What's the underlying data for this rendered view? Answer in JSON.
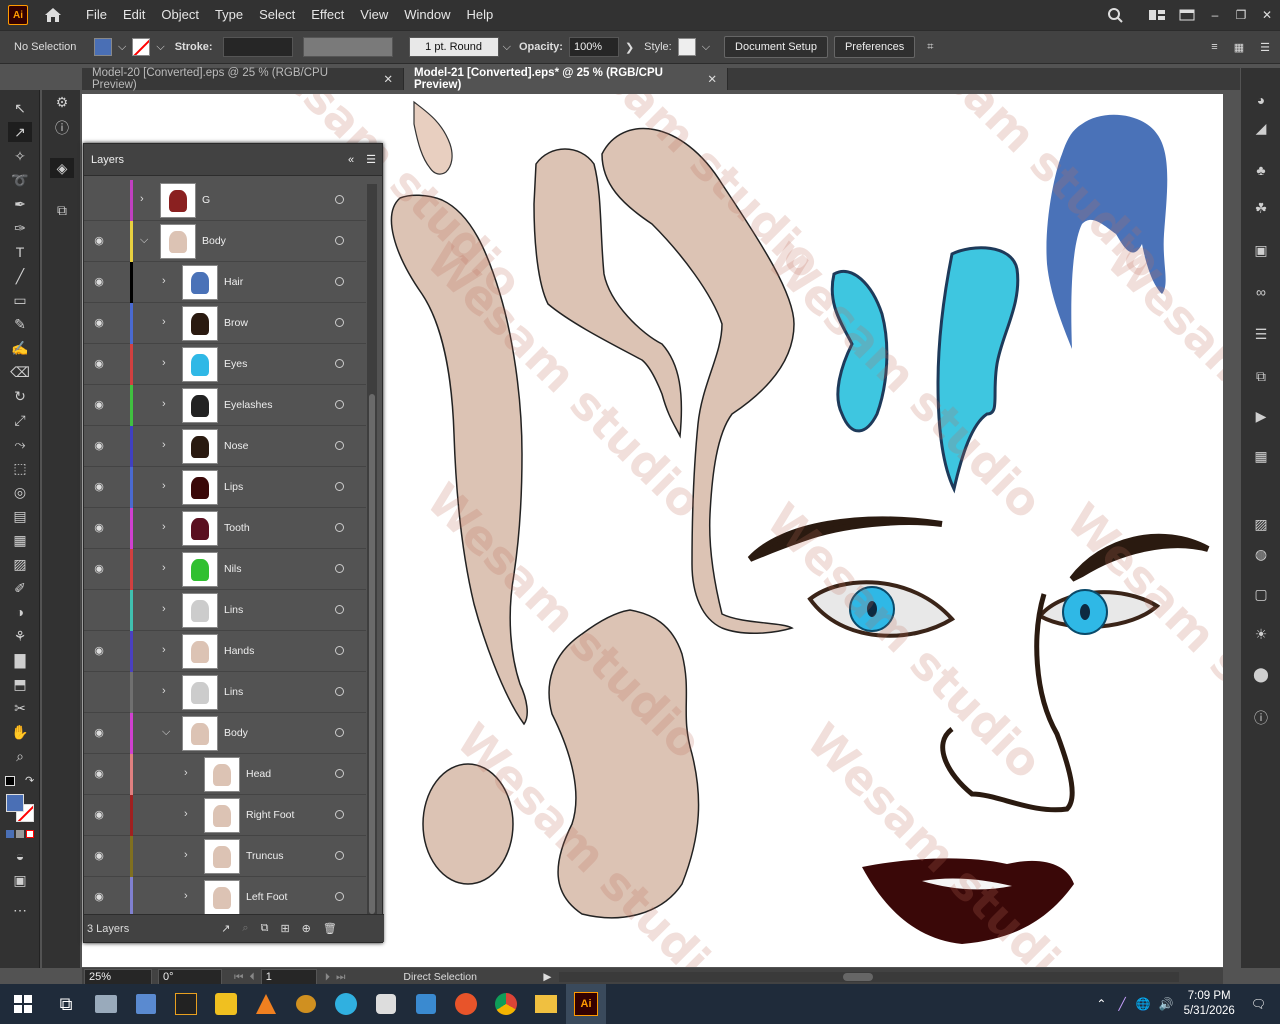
{
  "menubar": {
    "items": [
      "File",
      "Edit",
      "Object",
      "Type",
      "Select",
      "Effect",
      "View",
      "Window",
      "Help"
    ],
    "app_logo": "Ai"
  },
  "controlbar": {
    "selection": "No Selection",
    "stroke_label": "Stroke:",
    "brush": "1 pt. Round",
    "opacity_label": "Opacity:",
    "opacity_value": "100%",
    "style_label": "Style:",
    "document_setup": "Document Setup",
    "preferences": "Preferences",
    "fill_color": "#4a6fb5"
  },
  "tabs": [
    {
      "label": "Model-20 [Converted].eps @ 25 % (RGB/CPU Preview)",
      "active": false
    },
    {
      "label": "Model-21 [Converted].eps* @ 25 % (RGB/CPU Preview)",
      "active": true
    }
  ],
  "layers_panel": {
    "title": "Layers",
    "footer_count": "3 Layers",
    "rows": [
      {
        "name": "G",
        "color": "#c040c0",
        "eye": false,
        "level": 0,
        "expanded": false
      },
      {
        "name": "Body",
        "color": "#e8d040",
        "eye": true,
        "level": 0,
        "expanded": true
      },
      {
        "name": "Hair",
        "color": "#000000",
        "eye": true,
        "level": 1,
        "expanded": false
      },
      {
        "name": "Brow",
        "color": "#4a6ad0",
        "eye": true,
        "level": 1,
        "expanded": false
      },
      {
        "name": "Eyes",
        "color": "#d04040",
        "eye": true,
        "level": 1,
        "expanded": false
      },
      {
        "name": "Eyelashes",
        "color": "#40c040",
        "eye": true,
        "level": 1,
        "expanded": false
      },
      {
        "name": "Nose",
        "color": "#4040c0",
        "eye": true,
        "level": 1,
        "expanded": false
      },
      {
        "name": "Lips",
        "color": "#4a6ad0",
        "eye": true,
        "level": 1,
        "expanded": false
      },
      {
        "name": "Tooth",
        "color": "#d040d0",
        "eye": true,
        "level": 1,
        "expanded": false
      },
      {
        "name": "Nils",
        "color": "#d04040",
        "eye": true,
        "level": 1,
        "expanded": false
      },
      {
        "name": "Lins",
        "color": "#40c0b0",
        "eye": false,
        "level": 1,
        "expanded": false
      },
      {
        "name": "Hands",
        "color": "#4a40c0",
        "eye": true,
        "level": 1,
        "expanded": false
      },
      {
        "name": "Lins",
        "color": "#707070",
        "eye": false,
        "level": 1,
        "expanded": false
      },
      {
        "name": "Body",
        "color": "#d040d0",
        "eye": true,
        "level": 1,
        "expanded": true
      },
      {
        "name": "Head",
        "color": "#e08080",
        "eye": true,
        "level": 2,
        "expanded": false
      },
      {
        "name": "Right Foot",
        "color": "#a02020",
        "eye": true,
        "level": 2,
        "expanded": false
      },
      {
        "name": "Truncus",
        "color": "#807020",
        "eye": true,
        "level": 2,
        "expanded": false
      },
      {
        "name": "Left Foot",
        "color": "#8080d0",
        "eye": true,
        "level": 2,
        "expanded": false
      }
    ]
  },
  "statusbar": {
    "zoom": "25%",
    "rotation": "0°",
    "artboard": "1",
    "tool": "Direct Selection"
  },
  "watermark": "Wesam studio",
  "taskbar": {
    "time": "7:09 PM",
    "date": "5/31/2026",
    "ai_label": "Ai"
  }
}
